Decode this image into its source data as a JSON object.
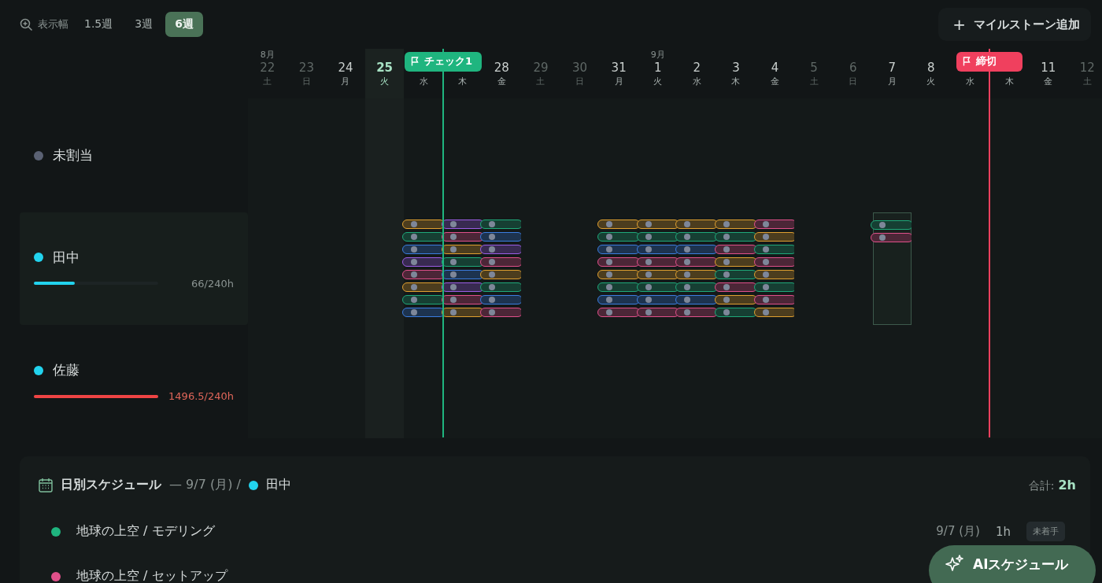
{
  "toolbar": {
    "zoom_label": "表示幅",
    "options": [
      {
        "label": "1.5週",
        "selected": false
      },
      {
        "label": "3週",
        "selected": false
      },
      {
        "label": "6週",
        "selected": true
      }
    ],
    "add_button": {
      "icon": "+",
      "label": "マイルストーン追加"
    }
  },
  "days": [
    {
      "month": "8月",
      "day": "22",
      "weekday": "土",
      "weekend": true,
      "today": false
    },
    {
      "day": "23",
      "weekday": "日",
      "weekend": true,
      "today": false
    },
    {
      "day": "24",
      "weekday": "月",
      "weekend": false,
      "today": false
    },
    {
      "day": "25",
      "weekday": "火",
      "weekend": false,
      "today": true
    },
    {
      "weekday": "水",
      "weekend": false,
      "today": false,
      "selected": false,
      "tasks": [
        {
          "color": "#e0a030"
        },
        {
          "color": "#1fa97a"
        },
        {
          "color": "#3b7de0"
        },
        {
          "color": "#9b5de5"
        },
        {
          "color": "#e0508a"
        },
        {
          "color": "#e0a030"
        },
        {
          "color": "#1fa97a"
        },
        {
          "color": "#3b7de0"
        }
      ]
    },
    {
      "weekday": "木",
      "weekend": false,
      "today": false,
      "selected": false,
      "milestone": {
        "label": "チェック1",
        "color": "#1fb57f"
      },
      "tasks": [
        {
          "color": "#9b5de5"
        },
        {
          "color": "#e0508a"
        },
        {
          "color": "#e0a030"
        },
        {
          "color": "#1fa97a"
        },
        {
          "color": "#3b7de0"
        },
        {
          "color": "#9b5de5"
        },
        {
          "color": "#e0508a"
        },
        {
          "color": "#e0a030"
        }
      ]
    },
    {
      "day": "28",
      "weekday": "金",
      "weekend": false,
      "today": false,
      "selected": false,
      "tasks": [
        {
          "color": "#1fa97a"
        },
        {
          "color": "#3b7de0"
        },
        {
          "color": "#9b5de5"
        },
        {
          "color": "#e0508a"
        },
        {
          "color": "#e0a030"
        },
        {
          "color": "#1fa97a"
        },
        {
          "color": "#3b7de0"
        },
        {
          "color": "#e0508a"
        }
      ]
    },
    {
      "day": "29",
      "weekday": "土",
      "weekend": true,
      "today": false
    },
    {
      "day": "30",
      "weekday": "日",
      "weekend": true,
      "today": false
    },
    {
      "day": "31",
      "weekday": "月",
      "weekend": false,
      "today": false,
      "selected": false,
      "tasks": [
        {
          "color": "#e0a030"
        },
        {
          "color": "#1fa97a"
        },
        {
          "color": "#3b7de0"
        },
        {
          "color": "#e0508a"
        },
        {
          "color": "#e0a030"
        },
        {
          "color": "#1fa97a"
        },
        {
          "color": "#3b7de0"
        },
        {
          "color": "#e0508a"
        }
      ]
    },
    {
      "month": "9月",
      "day": "1",
      "weekday": "火",
      "weekend": false,
      "today": false,
      "selected": false,
      "tasks": [
        {
          "color": "#e0a030"
        },
        {
          "color": "#1fa97a"
        },
        {
          "color": "#3b7de0"
        },
        {
          "color": "#e0508a"
        },
        {
          "color": "#e0a030"
        },
        {
          "color": "#1fa97a"
        },
        {
          "color": "#3b7de0"
        },
        {
          "color": "#e0508a"
        }
      ]
    },
    {
      "day": "2",
      "weekday": "水",
      "weekend": false,
      "today": false,
      "selected": false,
      "tasks": [
        {
          "color": "#e0a030"
        },
        {
          "color": "#1fa97a"
        },
        {
          "color": "#3b7de0"
        },
        {
          "color": "#e0508a"
        },
        {
          "color": "#e0a030"
        },
        {
          "color": "#1fa97a"
        },
        {
          "color": "#3b7de0"
        },
        {
          "color": "#e0508a"
        }
      ]
    },
    {
      "day": "3",
      "weekday": "木",
      "weekend": false,
      "today": false,
      "selected": false,
      "tasks": [
        {
          "color": "#e0a030"
        },
        {
          "color": "#1fa97a"
        },
        {
          "color": "#e0508a"
        },
        {
          "color": "#e0a030"
        },
        {
          "color": "#1fa97a"
        },
        {
          "color": "#e0508a"
        },
        {
          "color": "#e0a030"
        },
        {
          "color": "#1fa97a"
        }
      ]
    },
    {
      "day": "4",
      "weekday": "金",
      "weekend": false,
      "today": false,
      "selected": false,
      "tasks": [
        {
          "color": "#e0508a"
        },
        {
          "color": "#e0a030"
        },
        {
          "color": "#1fa97a"
        },
        {
          "color": "#e0508a"
        },
        {
          "color": "#e0a030"
        },
        {
          "color": "#1fa97a"
        },
        {
          "color": "#e0508a"
        },
        {
          "color": "#e0a030"
        }
      ]
    },
    {
      "day": "5",
      "weekday": "土",
      "weekend": true,
      "today": false
    },
    {
      "day": "6",
      "weekday": "日",
      "weekend": true,
      "today": false
    },
    {
      "day": "7",
      "weekday": "月",
      "weekend": false,
      "today": false,
      "selected": true,
      "tasks": [
        {
          "color": "#1fa97a"
        },
        {
          "color": "#e0508a"
        }
      ]
    },
    {
      "day": "8",
      "weekday": "火",
      "weekend": false,
      "today": false
    },
    {
      "weekday": "水",
      "weekend": false,
      "today": false
    },
    {
      "weekday": "木",
      "weekend": false,
      "today": false,
      "milestone": {
        "label": "締切",
        "color": "#f0405e"
      }
    },
    {
      "day": "11",
      "weekday": "金",
      "weekend": false,
      "today": false
    },
    {
      "day": "12",
      "weekday": "土",
      "weekend": true,
      "today": false
    }
  ],
  "members": [
    {
      "name": "未割当",
      "color": "#5a6173",
      "selected": false
    },
    {
      "name": "田中",
      "color": "#22d3ee",
      "selected": true,
      "level": 0.33,
      "over": false,
      "load": "66/240h"
    },
    {
      "name": "佐藤",
      "color": "#22d3ee",
      "selected": false,
      "level": 1,
      "over": true,
      "load": "1496.5/240h"
    }
  ],
  "daily": {
    "title": "日別スケジュール",
    "date": "— 9/7 (月) /",
    "member": {
      "name": "田中",
      "color": "#22d3ee"
    },
    "total_label": "合計:",
    "total": "2h",
    "tasks": [
      {
        "name": "地球の上空 / モデリング",
        "color": "#1fb57f",
        "date": "9/7 (月)",
        "hours": "1h",
        "status": "未着手"
      },
      {
        "name": "地球の上空 / セットアップ",
        "color": "#e0508a"
      }
    ]
  },
  "ai_button": {
    "label": "AIスケジュール"
  }
}
